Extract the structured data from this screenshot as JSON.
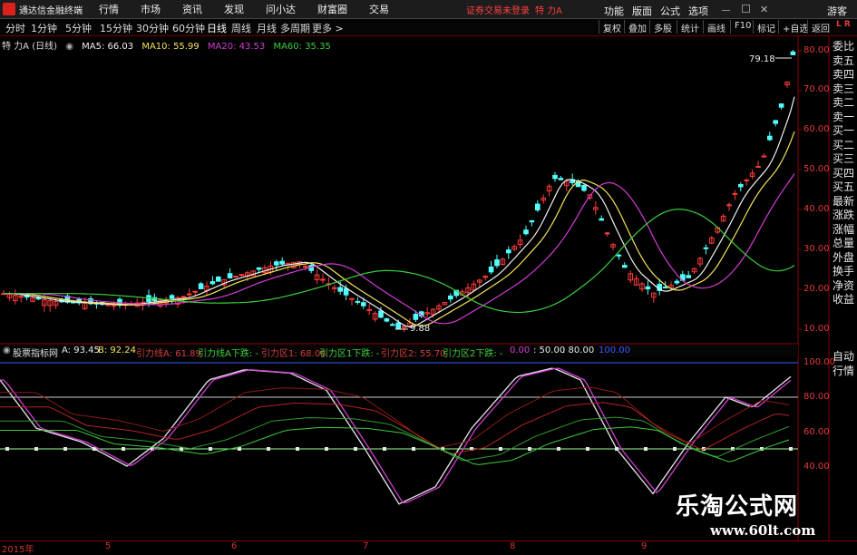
{
  "menubar": {
    "app_name": "通达信金融终端",
    "items": [
      "行情",
      "市场",
      "资讯",
      "发现",
      "问小达",
      "财富圈",
      "交易"
    ],
    "status_text": "证券交易未登录",
    "stock_name": "特 力A",
    "right_items": [
      "功能",
      "版面",
      "公式",
      "选项"
    ],
    "guest": "游客"
  },
  "toolbar": {
    "periods": [
      "分时",
      "1分钟",
      "5分钟",
      "15分钟",
      "30分钟",
      "60分钟",
      "日线",
      "周线",
      "月线",
      "多周期",
      "更多 >"
    ],
    "active_period": "日线",
    "right_buttons": [
      "复权",
      "叠加",
      "多股",
      "统计",
      "画线",
      "F10",
      "标记",
      "+自选",
      "返回"
    ]
  },
  "main_chart": {
    "title": "特 力A (日线)",
    "ma": [
      {
        "label": "MA5: 66.03",
        "color": "#f0f0f0"
      },
      {
        "label": "MA10: 55.99",
        "color": "#f5e35a"
      },
      {
        "label": "MA20: 43.53",
        "color": "#d23cd2"
      },
      {
        "label": "MA60: 35.35",
        "color": "#3ccd3c"
      }
    ],
    "y_ticks": [
      "80.00",
      "70.00",
      "60.00",
      "50.00",
      "40.00",
      "30.00",
      "20.00",
      "10.00"
    ],
    "high_label": "79.18",
    "low_label": "9.88"
  },
  "right_panel": {
    "items": [
      "委比",
      "卖五",
      "卖四",
      "卖三",
      "卖二",
      "卖一",
      "买一",
      "买二",
      "买三",
      "买四",
      "买五",
      "最新",
      "涨跌",
      "涨幅",
      "总量",
      "外盘",
      "换手",
      "净资",
      "收益"
    ],
    "bottom_items": [
      "自动",
      "行情"
    ]
  },
  "sub_chart": {
    "title": "股票指标网",
    "fields": [
      {
        "label": "A: 93.45",
        "color": "#e8e8e8"
      },
      {
        "label": "B: 92.24",
        "color": "#f5e35a"
      },
      {
        "label": "引力线A: 61.89",
        "color": "#d23c3c"
      },
      {
        "label": "引力线A下跌: -",
        "color": "#3ccd3c"
      },
      {
        "label": "引力区1: 68.08",
        "color": "#d23c3c"
      },
      {
        "label": "引力区1下跌: -",
        "color": "#3ccd3c"
      },
      {
        "label": "引力区2: 55.70",
        "color": "#d23c3c"
      },
      {
        "label": "引力区2下跌: -",
        "color": "#3ccd3c"
      },
      {
        "label": "0.00",
        "color": "#d23cd2"
      },
      {
        "label": ": 50.00",
        "color": "#e8e8e8"
      },
      {
        "label": ": 80.00",
        "color": "#e8e8e8"
      },
      {
        "label": "100.00",
        "color": "#3c5cff"
      }
    ],
    "y_ticks": [
      "100.00",
      "80.00",
      "60.00",
      "40.00"
    ]
  },
  "time_axis": [
    "2015年",
    "5",
    "6",
    "7",
    "8",
    "9"
  ],
  "watermark": {
    "title": "乐淘公式网",
    "url": "www.60lt.com"
  },
  "colors": {
    "up": "#ff3b3b",
    "down": "#54ffff",
    "background": "#000000"
  }
}
